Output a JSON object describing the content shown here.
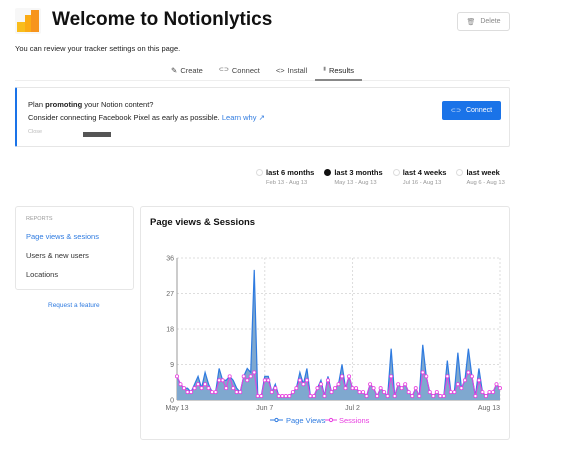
{
  "header": {
    "title": "Welcome to Notionlytics",
    "subtitle": "You can review your tracker settings on this page.",
    "delete_label": "Delete"
  },
  "tabs": [
    {
      "label": "Create",
      "icon": "✎"
    },
    {
      "label": "Connect",
      "icon": "⊂⊃"
    },
    {
      "label": "Install",
      "icon": "<>"
    },
    {
      "label": "Results",
      "icon": "▮"
    }
  ],
  "banner": {
    "line1_pre": "Plan ",
    "line1_bold": "promoting",
    "line1_post": " your Notion content?",
    "line2": "Consider connecting Facebook Pixel as early as possible.",
    "learn": "Learn why",
    "close": "Close",
    "connect": "Connect"
  },
  "ranges": [
    {
      "label": "last 6 months",
      "dates": "Feb 13 - Aug 13",
      "selected": false
    },
    {
      "label": "last 3 months",
      "dates": "May 13 - Aug 13",
      "selected": true
    },
    {
      "label": "last 4 weeks",
      "dates": "Jul 16 - Aug 13",
      "selected": false
    },
    {
      "label": "last week",
      "dates": "Aug 6 - Aug 13",
      "selected": false
    }
  ],
  "sidebar": {
    "heading": "REPORTS",
    "items": [
      "Page views & sesions",
      "Users & new users",
      "Locations"
    ],
    "request": "Request a feature"
  },
  "colors": {
    "accent": "#1a73e8",
    "pageviews": "#2f7be0",
    "sessions": "#e83fe0"
  },
  "chart_data": {
    "type": "area",
    "title": "Page views & Sessions",
    "ylim": [
      0,
      36
    ],
    "yticks": [
      "0",
      "9",
      "18",
      "27",
      "36"
    ],
    "xticks": [
      {
        "label": "May 13",
        "i": 0
      },
      {
        "label": "Jun 7",
        "i": 25
      },
      {
        "label": "Jul 2",
        "i": 50
      },
      {
        "label": "Aug 13",
        "i": 92
      }
    ],
    "series": [
      {
        "name": "Page Views",
        "values": [
          6,
          4,
          3,
          3,
          2,
          4,
          6,
          3,
          7,
          4,
          2,
          2,
          8,
          5,
          5,
          6,
          5,
          3,
          2,
          6,
          8,
          7,
          33,
          1,
          1,
          6,
          6,
          2,
          4,
          1,
          1,
          1,
          1,
          2,
          3,
          7,
          4,
          8,
          1,
          1,
          3,
          5,
          1,
          6,
          2,
          3,
          4,
          9,
          3,
          6,
          3,
          3,
          2,
          2,
          1,
          4,
          3,
          1,
          3,
          2,
          1,
          13,
          1,
          4,
          3,
          4,
          2,
          1,
          3,
          1,
          14,
          6,
          2,
          1,
          2,
          1,
          1,
          10,
          2,
          2,
          12,
          3,
          5,
          13,
          6,
          1,
          8,
          2,
          1,
          2,
          2,
          4,
          3
        ]
      },
      {
        "name": "Sessions",
        "values": [
          6,
          4,
          3,
          2,
          2,
          3,
          4,
          3,
          4,
          3,
          2,
          2,
          5,
          5,
          3,
          6,
          3,
          2,
          2,
          6,
          5,
          6,
          7,
          1,
          1,
          5,
          5,
          2,
          3,
          1,
          1,
          1,
          1,
          2,
          3,
          5,
          4,
          5,
          1,
          1,
          3,
          4,
          1,
          5,
          2,
          3,
          4,
          6,
          3,
          6,
          3,
          3,
          2,
          2,
          1,
          4,
          3,
          1,
          3,
          2,
          1,
          6,
          1,
          4,
          3,
          4,
          2,
          1,
          3,
          1,
          7,
          6,
          2,
          1,
          2,
          1,
          1,
          6,
          2,
          2,
          4,
          3,
          5,
          7,
          6,
          1,
          5,
          2,
          1,
          2,
          2,
          4,
          3
        ]
      }
    ]
  }
}
